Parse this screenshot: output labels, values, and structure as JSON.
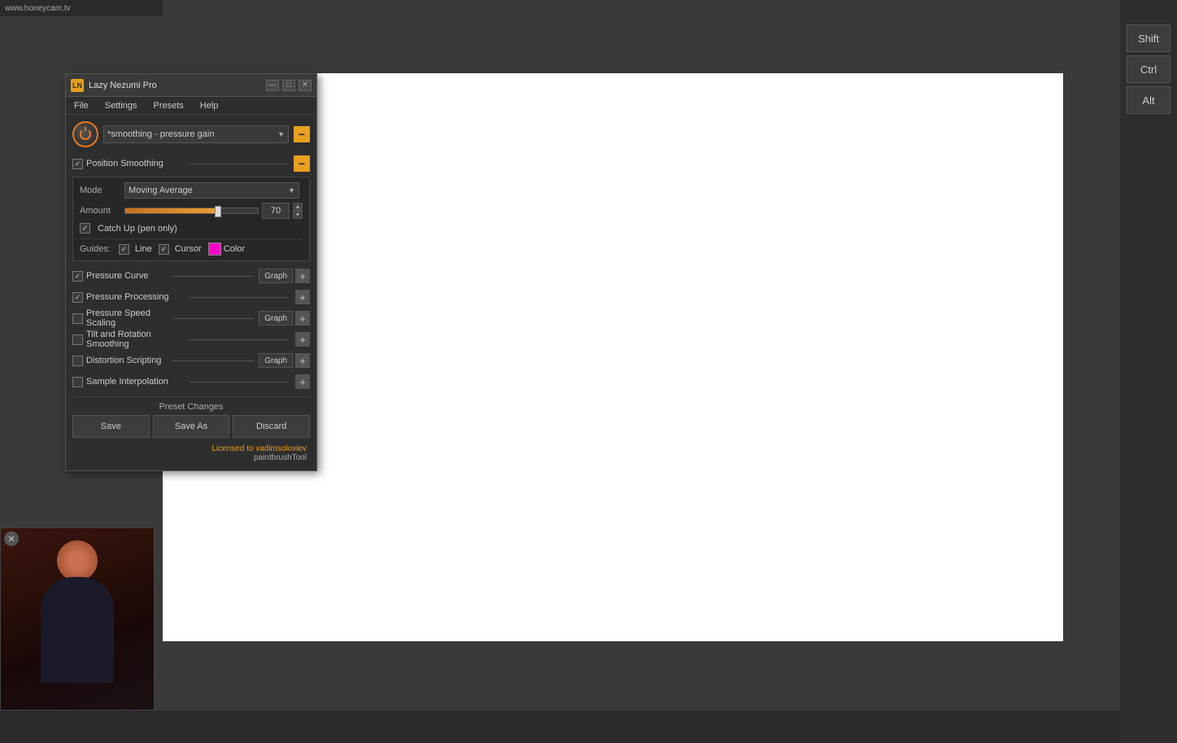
{
  "browser": {
    "url": "www.honeycam.tv"
  },
  "keyboard": {
    "shift": "Shift",
    "ctrl": "Ctrl",
    "alt": "Alt"
  },
  "app": {
    "title": "Lazy Nezumi Pro",
    "logo": "LN",
    "menu": {
      "file": "File",
      "settings": "Settings",
      "presets": "Presets",
      "help": "Help"
    },
    "title_controls": {
      "minimize": "—",
      "maximize": "□",
      "close": "✕"
    },
    "preset": {
      "name": "*smoothing - pressure gain"
    },
    "position_smoothing": {
      "label": "Position Smoothing",
      "mode_label": "Mode",
      "mode_value": "Moving Average",
      "amount_label": "Amount",
      "amount_value": "70",
      "catchup_label": "Catch Up (pen only)"
    },
    "guides": {
      "label": "Guides:",
      "line_label": "Line",
      "cursor_label": "Cursor",
      "color_label": "Color"
    },
    "sections": [
      {
        "id": "pressure-curve",
        "label": "Pressure Curve",
        "checked": true,
        "hasGraph": true,
        "hasPlus": true
      },
      {
        "id": "pressure-processing",
        "label": "Pressure Processing",
        "checked": true,
        "hasGraph": false,
        "hasPlus": true
      },
      {
        "id": "pressure-speed-scaling",
        "label": "Pressure Speed Scaling",
        "checked": false,
        "hasGraph": true,
        "hasPlus": true
      },
      {
        "id": "tilt-rotation-smoothing",
        "label": "Tilt and Rotation Smoothing",
        "checked": false,
        "hasGraph": false,
        "hasPlus": true
      },
      {
        "id": "distortion-scripting",
        "label": "Distortion Scripting",
        "checked": false,
        "hasGraph": true,
        "hasPlus": true
      },
      {
        "id": "sample-interpolation",
        "label": "Sample Interpolation",
        "checked": false,
        "hasGraph": false,
        "hasPlus": true
      }
    ],
    "preset_changes": {
      "label": "Preset Changes",
      "save": "Save",
      "save_as": "Save As",
      "discard": "Discard"
    },
    "footer": {
      "licensed": "Licensed to vadimsoloviev",
      "tool": "paintbrushTool"
    }
  }
}
